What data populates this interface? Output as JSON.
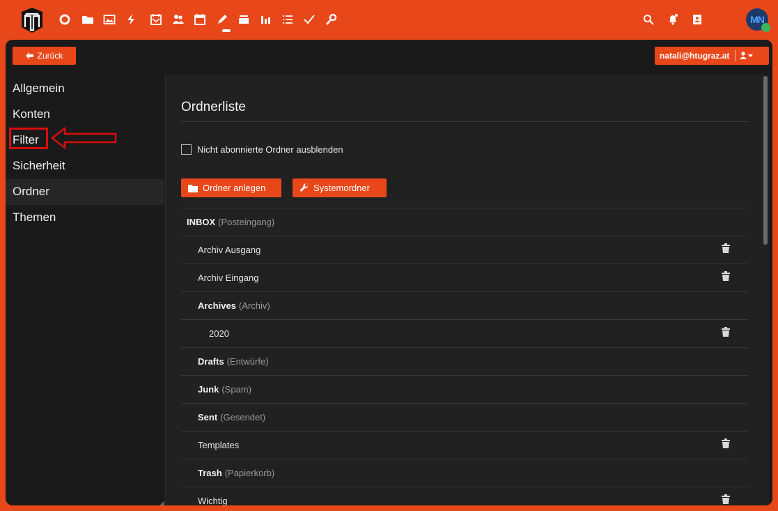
{
  "nav": {
    "icons": [
      "logo-icon",
      "circle-icon",
      "folder-icon",
      "image-icon",
      "bolt-icon",
      "calendar-mail-icon",
      "users-icon",
      "calendar-icon",
      "pencil-icon",
      "stack-icon",
      "chart-icon",
      "list-icon",
      "check-icon",
      "key-icon",
      "search-icon",
      "bell-icon",
      "contact-card-icon"
    ],
    "avatar_initials": "MN"
  },
  "toolbar": {
    "back_label": "Zurück",
    "user_email": "natali@htugraz.at"
  },
  "sidebar": {
    "items": [
      {
        "label": "Allgemein"
      },
      {
        "label": "Konten"
      },
      {
        "label": "Filter"
      },
      {
        "label": "Sicherheit"
      },
      {
        "label": "Ordner"
      },
      {
        "label": "Themen"
      }
    ],
    "active": "Ordner",
    "highlighted": "Filter"
  },
  "panel": {
    "title": "Ordnerliste",
    "hide_unsubscribed_label": "Nicht abonnierte Ordner ausblenden",
    "hide_unsubscribed_checked": false,
    "create_folder_label": "Ordner anlegen",
    "system_folders_label": "Systemordner"
  },
  "folders": [
    {
      "name": "INBOX",
      "sub": "(Posteingang)",
      "bold": true,
      "level": 0,
      "deletable": false
    },
    {
      "name": "Archiv Ausgang",
      "sub": "",
      "bold": false,
      "level": 1,
      "deletable": true
    },
    {
      "name": "Archiv Eingang",
      "sub": "",
      "bold": false,
      "level": 1,
      "deletable": true
    },
    {
      "name": "Archives",
      "sub": "(Archiv)",
      "bold": true,
      "level": 1,
      "deletable": false
    },
    {
      "name": "2020",
      "sub": "",
      "bold": false,
      "level": 2,
      "deletable": true
    },
    {
      "name": "Drafts",
      "sub": "(Entwürfe)",
      "bold": true,
      "level": 1,
      "deletable": false
    },
    {
      "name": "Junk",
      "sub": "(Spam)",
      "bold": true,
      "level": 1,
      "deletable": false
    },
    {
      "name": "Sent",
      "sub": "(Gesendet)",
      "bold": true,
      "level": 1,
      "deletable": false
    },
    {
      "name": "Templates",
      "sub": "",
      "bold": false,
      "level": 1,
      "deletable": true
    },
    {
      "name": "Trash",
      "sub": "(Papierkorb)",
      "bold": true,
      "level": 1,
      "deletable": false
    },
    {
      "name": "Wichtig",
      "sub": "",
      "bold": false,
      "level": 1,
      "deletable": true
    }
  ],
  "colors": {
    "accent": "#e8471a",
    "background": "#1a1a1a",
    "panel": "#212121",
    "highlight_box": "#d90d0d"
  }
}
